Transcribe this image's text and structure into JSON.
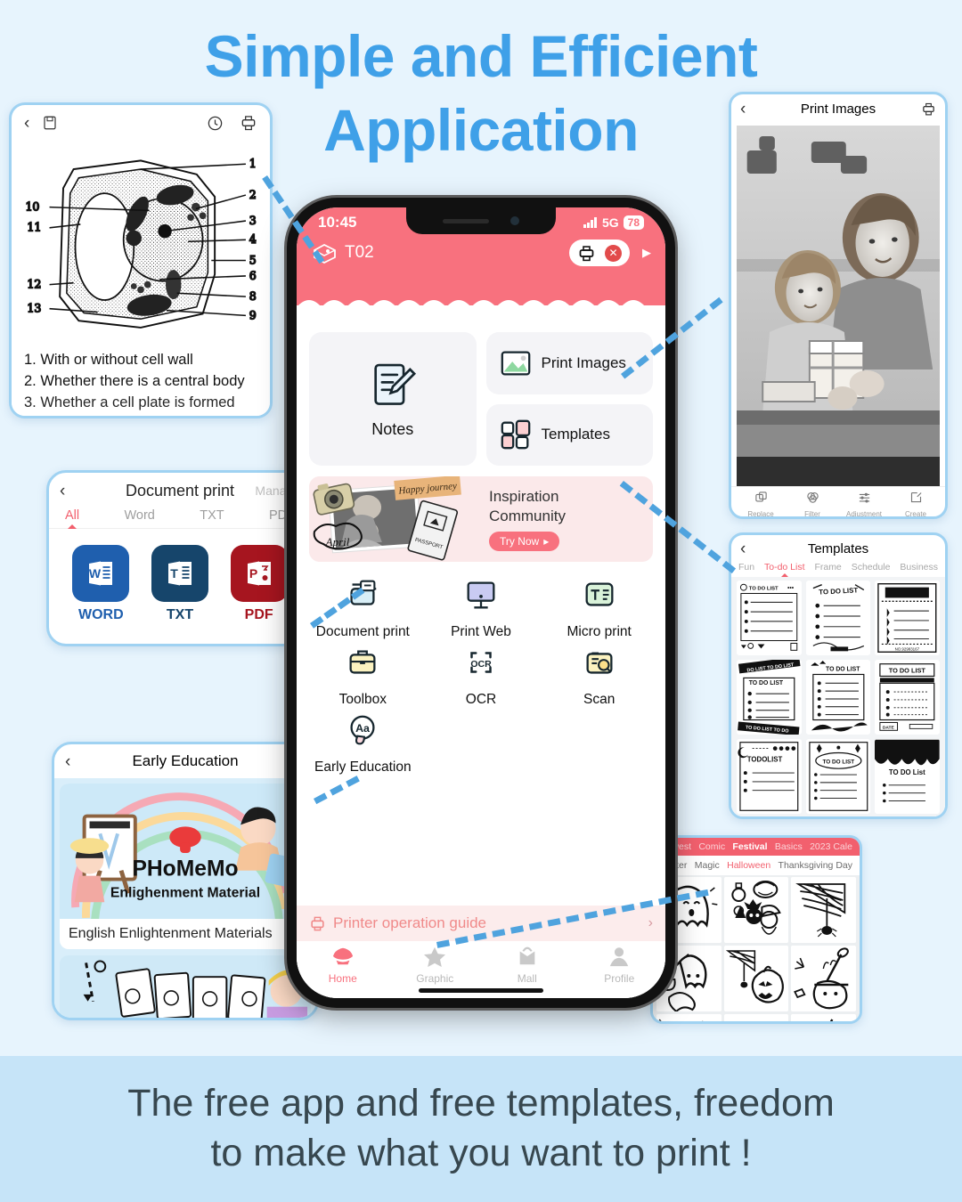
{
  "headline": {
    "line1": "Simple and Efficient",
    "line2": "Application"
  },
  "footer": {
    "line1": "The free app and free templates, freedom",
    "line2": "to make what you want to print !"
  },
  "colors": {
    "accent_blue": "#3FA0E8",
    "accent_pink": "#F8717E",
    "bg": "#E7F4FD",
    "band": "#C6E4F8",
    "dash": "#4FA3DE"
  },
  "phone": {
    "status": {
      "time": "10:45",
      "network": "5G",
      "battery": "78"
    },
    "device": {
      "name": "T02"
    },
    "quick": [
      {
        "label": "Notes",
        "icon": "note-pencil-icon"
      },
      {
        "label": "Print Images",
        "icon": "image-icon"
      },
      {
        "label": "Templates",
        "icon": "grid-icon"
      }
    ],
    "banner": {
      "title_line1": "Inspiration",
      "title_line2": "Community",
      "button": "Try Now",
      "sticker": "Happy journey",
      "caption": "April"
    },
    "features": [
      {
        "label": "Document print",
        "icon": "printer-doc-icon"
      },
      {
        "label": "Print Web",
        "icon": "monitor-icon"
      },
      {
        "label": "Micro print",
        "icon": "text-box-icon"
      },
      {
        "label": "Toolbox",
        "icon": "toolbox-icon"
      },
      {
        "label": "OCR",
        "icon": "ocr-icon"
      },
      {
        "label": "Scan",
        "icon": "scan-icon"
      },
      {
        "label": "Early Education",
        "icon": "aa-bubble-icon"
      }
    ],
    "guide": {
      "label": "Printer operation guide",
      "icon": "printer-guide-icon"
    },
    "tabs": [
      {
        "label": "Home",
        "icon": "home-icon",
        "active": true
      },
      {
        "label": "Graphic",
        "icon": "star-icon",
        "active": false
      },
      {
        "label": "Mall",
        "icon": "bag-icon",
        "active": false
      },
      {
        "label": "Profile",
        "icon": "person-icon",
        "active": false
      }
    ]
  },
  "card_cell": {
    "title": "",
    "icons": [
      "back-icon",
      "save-icon",
      "history-icon",
      "printer-icon"
    ],
    "lines": [
      "1. With or without cell wall",
      "2. Whether there is a central body",
      "3. Whether a cell plate is formed"
    ],
    "diagram_labels_right": [
      "1",
      "2",
      "3",
      "4",
      "5",
      "6",
      "8",
      "9"
    ],
    "diagram_labels_left": [
      "10",
      "11",
      "12",
      "13"
    ]
  },
  "card_doc": {
    "title": "Document print",
    "manage": "Manage",
    "tabs": [
      {
        "label": "All",
        "active": true
      },
      {
        "label": "Word",
        "active": false
      },
      {
        "label": "TXT",
        "active": false
      },
      {
        "label": "PDF",
        "active": false
      }
    ],
    "types": [
      {
        "label": "WORD",
        "letter": "W",
        "color": "#1F5FAE",
        "text_color": "#1F5FAE"
      },
      {
        "label": "TXT",
        "letter": "T",
        "color": "#16456B",
        "text_color": "#16456B"
      },
      {
        "label": "PDF",
        "letter": "P",
        "color": "#A6151F",
        "text_color": "#A6151F"
      }
    ]
  },
  "card_edu": {
    "title": "Early Education",
    "brand": "PHoMeMo",
    "banner_caption": "Enlighenment Material",
    "item_caption": "English Enlightenment Materials"
  },
  "card_print": {
    "title": "Print Images",
    "tools": [
      {
        "label": "Replace",
        "icon": "replace-icon"
      },
      {
        "label": "Filter",
        "icon": "filter-icon"
      },
      {
        "label": "Adjustment",
        "icon": "sliders-icon"
      },
      {
        "label": "Create",
        "icon": "edit-icon"
      }
    ]
  },
  "card_templates": {
    "title": "Templates",
    "tabs": [
      {
        "label": "Fun",
        "active": false
      },
      {
        "label": "To-do List",
        "active": true
      },
      {
        "label": "Frame",
        "active": false
      },
      {
        "label": "Schedule",
        "active": false
      },
      {
        "label": "Business",
        "active": false
      }
    ],
    "items": [
      "TO DO LIST",
      "TO DO LIST",
      "TO DO LIST",
      "TO DO LIST",
      "TO DO LIST",
      "TO DO LIST",
      "TODOLIST",
      "TO DO LIST",
      "TO DO LIST"
    ]
  },
  "card_halloween": {
    "tabs_primary": [
      {
        "label": "Newest",
        "active": false
      },
      {
        "label": "Comic",
        "active": false
      },
      {
        "label": "Festival",
        "active": true
      },
      {
        "label": "Basics",
        "active": false
      },
      {
        "label": "2023 Cale",
        "active": false
      }
    ],
    "tabs_secondary": [
      {
        "label": "Easter",
        "active": false
      },
      {
        "label": "Magic",
        "active": false
      },
      {
        "label": "Halloween",
        "active": true
      },
      {
        "label": "Thanksgiving Day",
        "active": false
      }
    ],
    "stickers": [
      "ghost",
      "potion-cat-witch",
      "spider-web",
      "broom-ghost",
      "pumpkin-web",
      "cauldron",
      "ghost-small",
      "bats",
      "bone-cauldron"
    ]
  }
}
